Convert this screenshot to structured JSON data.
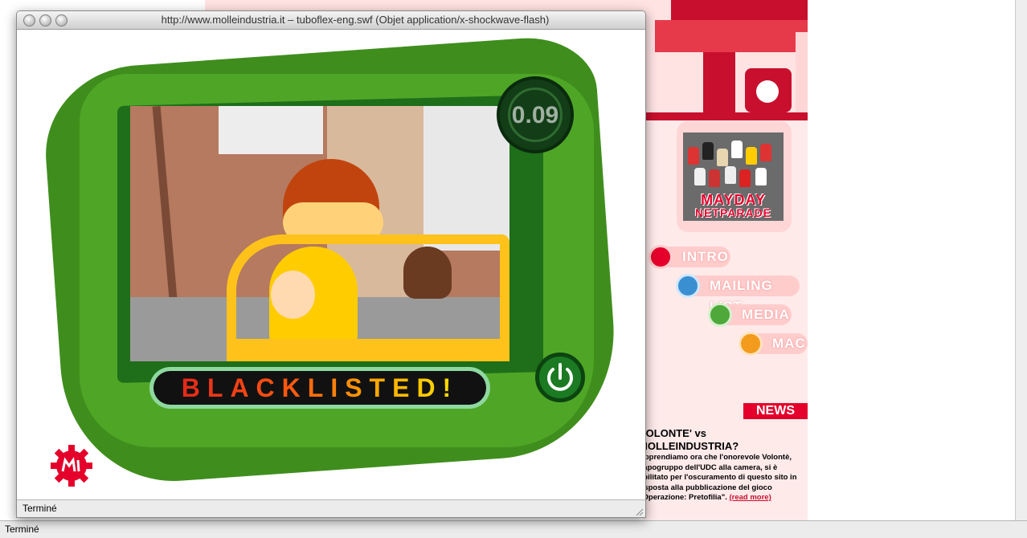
{
  "popup": {
    "title": "http://www.molleindustria.it – tuboflex-eng.swf (Objet application/x-shockwave-flash)",
    "status": "Terminé"
  },
  "game": {
    "timer": "0.09",
    "banner": "BLACKLISTED!"
  },
  "site": {
    "mayday_line1": "MAYDAY",
    "mayday_line2": "NETPARADE",
    "nav": [
      {
        "label": "INTRO",
        "icon": "mi-gear-icon"
      },
      {
        "label": "MAILING LIST",
        "icon": "envelope-icon"
      },
      {
        "label": "MEDIA",
        "icon": "broadcast-icon"
      },
      {
        "label": "MAC",
        "icon": "apple-icon"
      }
    ],
    "news": {
      "heading": "NEWS",
      "title": "VOLONTE' vs MOLLEINDUSTRIA?",
      "body": "Apprendiamo ora che l'onorevole Volontè, capogruppo dell'UDC alla camera, si è abilitato per l'oscuramento di questo sito in risposta alla pubblicazione del gioco \"Operazione: Pretofilia\".",
      "more": "(read more)"
    }
  },
  "browser": {
    "status": "Terminé"
  },
  "colors": {
    "brand_red": "#e4002b",
    "device_green": "#4fa626",
    "banner_black": "#111111"
  }
}
